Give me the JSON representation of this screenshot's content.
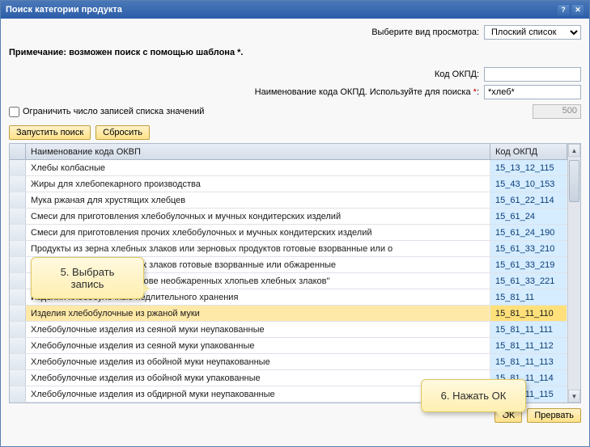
{
  "window": {
    "title": "Поиск категории продукта"
  },
  "view": {
    "label": "Выберите вид просмотра:",
    "selected": "Плоский список"
  },
  "note": "Примечание: возможен поиск с помощью шаблона *.",
  "fields": {
    "okpd_label": "Код ОКПД:",
    "okpd_value": "",
    "name_label": "Наименование кода ОКПД. Используйте для поиска",
    "name_value": "*хлеб*"
  },
  "limit": {
    "label": "Ограничить число записей списка значений",
    "count": "500"
  },
  "buttons": {
    "search": "Запустить поиск",
    "reset": "Сбросить",
    "ok": "OK",
    "cancel": "Прервать"
  },
  "grid": {
    "headers": {
      "name": "Наименование кода ОКВП",
      "code": "Код ОКПД"
    },
    "selected_index": 9,
    "rows": [
      {
        "name": "Хлебы колбасные",
        "code": "15_13_12_115"
      },
      {
        "name": "Жиры для хлебопекарного производства",
        "code": "15_43_10_153"
      },
      {
        "name": "Мука ржаная для хрустящих хлебцев",
        "code": "15_61_22_114"
      },
      {
        "name": "Смеси для приготовления хлебобулочных и мучных кондитерских изделий",
        "code": "15_61_24"
      },
      {
        "name": "Смеси для приготовления прочих хлебобулочных и мучных кондитерских изделий",
        "code": "15_61_24_190"
      },
      {
        "name": "Продукты из зерна хлебных злаков или зерновых продуктов готовые взорванные или о",
        "code": "15_61_33_210"
      },
      {
        "name": "Продукты из зерна хлебных злаков готовые взорванные или обжаренные",
        "code": "15_61_33_219"
      },
      {
        "name": "\"Продукты пищевые на основе необжаренных хлопьев хлебных злаков\"",
        "code": "15_61_33_221"
      },
      {
        "name": "Изделия хлебобулочные недлительного хранения",
        "code": "15_81_11"
      },
      {
        "name": "Изделия хлебобулочные из ржаной муки",
        "code": "15_81_11_110"
      },
      {
        "name": "Хлебобулочные изделия из сеяной муки неупакованные",
        "code": "15_81_11_111"
      },
      {
        "name": "Хлебобулочные изделия из сеяной муки упакованные",
        "code": "15_81_11_112"
      },
      {
        "name": "Хлебобулочные изделия из обойной муки неупакованные",
        "code": "15_81_11_113"
      },
      {
        "name": "Хлебобулочные изделия из обойной муки упакованные",
        "code": "15_81_11_114"
      },
      {
        "name": "Хлебобулочные изделия из обдирной муки неупакованные",
        "code": "15_81_11_115"
      }
    ]
  },
  "callouts": {
    "c1": "5. Выбрать запись",
    "c2": "6. Нажать ОК"
  }
}
